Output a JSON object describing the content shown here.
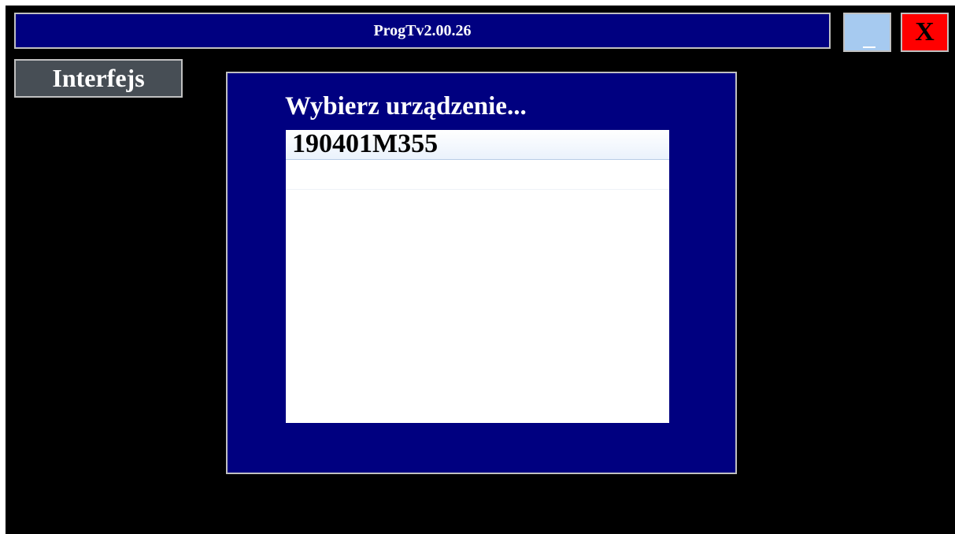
{
  "window": {
    "title": "ProgTv2.00.26",
    "minimize_icon": "minimize-icon",
    "close_label": "X"
  },
  "mode_button": {
    "label": "Interfejs"
  },
  "dialog": {
    "heading": "Wybierz urządzenie...",
    "devices": [
      "190401M355",
      ""
    ],
    "selected_index": 0
  },
  "colors": {
    "background": "#000000",
    "title_bar": "#000080",
    "dialog": "#000080",
    "minimize_button": "#a6caf0",
    "close_button": "#ff0000",
    "mode_button": "#474e55",
    "border": "#c0c0c0"
  }
}
